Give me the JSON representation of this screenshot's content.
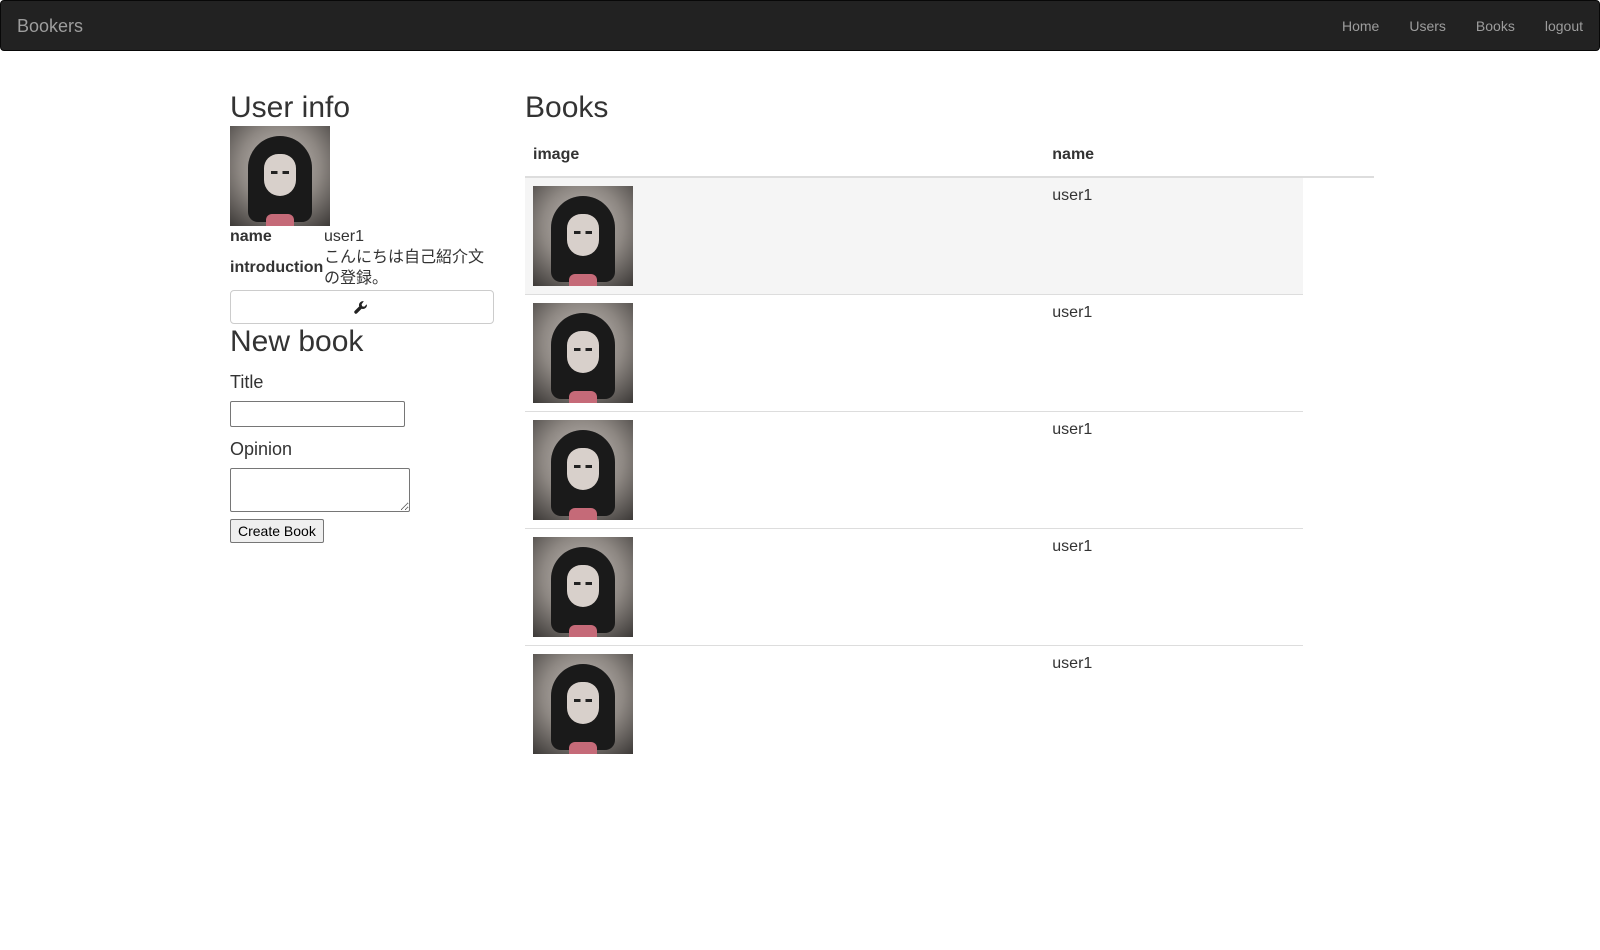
{
  "navbar": {
    "brand": "Bookers",
    "links": [
      "Home",
      "Users",
      "Books",
      "logout"
    ]
  },
  "user_info": {
    "heading": "User info",
    "avatar_icon": "user-avatar-icon",
    "name_label": "name",
    "name_value": "user1",
    "intro_label": "introduction",
    "intro_value": "こんにちは自己紹介文の登録。",
    "edit_icon": "wrench-icon"
  },
  "new_book": {
    "heading": "New book",
    "title_label": "Title",
    "title_value": "",
    "opinion_label": "Opinion",
    "opinion_value": "",
    "submit_label": "Create Book"
  },
  "books": {
    "heading": "Books",
    "columns": [
      "image",
      "name"
    ],
    "rows": [
      {
        "image": "book-cover-image",
        "name": "user1"
      },
      {
        "image": "book-cover-image",
        "name": "user1"
      },
      {
        "image": "book-cover-image",
        "name": "user1"
      },
      {
        "image": "book-cover-image",
        "name": "user1"
      },
      {
        "image": "book-cover-image",
        "name": "user1"
      }
    ]
  }
}
